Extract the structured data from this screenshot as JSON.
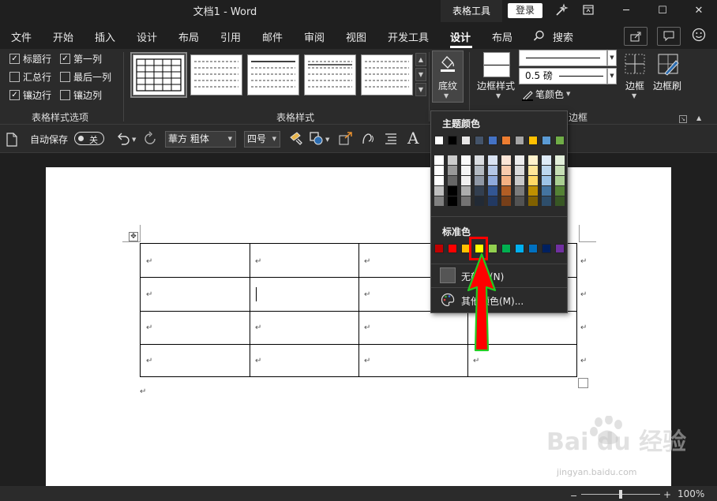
{
  "window": {
    "title": "文档1  -  Word",
    "context_tab": "表格工具",
    "login": "登录",
    "min": "─",
    "max": "☐",
    "close": "✕"
  },
  "menu": {
    "items": [
      "文件",
      "开始",
      "插入",
      "设计",
      "布局",
      "引用",
      "邮件",
      "审阅",
      "视图",
      "开发工具",
      "设计",
      "布局",
      "搜索"
    ],
    "active_index": 10
  },
  "ribbon": {
    "options": {
      "header_row": "标题行",
      "first_col": "第一列",
      "total_row": "汇总行",
      "last_col": "最后一列",
      "banded_rows": "镶边行",
      "banded_cols": "镶边列",
      "group_label": "表格样式选项"
    },
    "styles_group_label": "表格样式",
    "shading_label": "底纹",
    "border_styles_label": "边框样式",
    "line_weight": "0.5 磅",
    "pen_color": "笔颜色",
    "borders_label": "边框",
    "border_painter_label": "边框刷",
    "borders_group_label": "边框"
  },
  "qat": {
    "autosave": "自动保存",
    "autosave_state": "关",
    "font_name": "華方 粗体",
    "font_size": "四号"
  },
  "dropdown": {
    "theme_title": "主题颜色",
    "standard_title": "标准色",
    "no_color": "无颜色(N)",
    "more_colors": "其他颜色(M)...",
    "theme_colors": [
      "#ffffff",
      "#000000",
      "#e7e6e6",
      "#44546a",
      "#4472c4",
      "#ed7d31",
      "#a5a5a5",
      "#ffc000",
      "#5b9bd5",
      "#70ad47"
    ],
    "standard_colors": [
      "#c00000",
      "#ff0000",
      "#ffc000",
      "#ffff00",
      "#92d050",
      "#00b050",
      "#00b0f0",
      "#0070c0",
      "#002060",
      "#7030a0"
    ]
  },
  "status": {
    "zoom": "100%"
  },
  "watermark": {
    "text": "Bai du 经验",
    "url": "jingyan.baidu.com"
  },
  "colors": {
    "arrow_fill": "#ff0000",
    "arrow_outline": "#22cc22",
    "highlight": "#ff0000"
  }
}
